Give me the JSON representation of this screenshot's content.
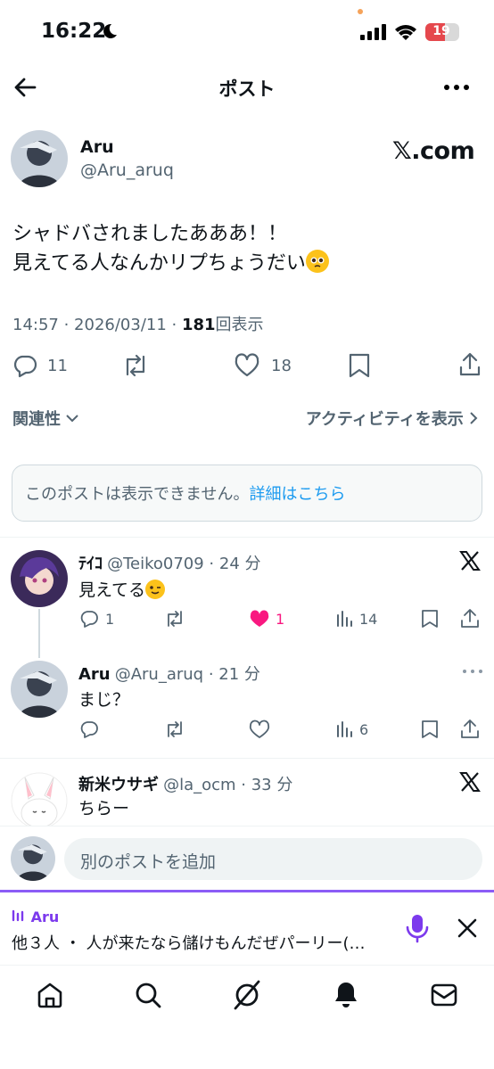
{
  "status_bar": {
    "time": "16:22",
    "battery": "19"
  },
  "header": {
    "title": "ポスト"
  },
  "post": {
    "author_name": "Aru",
    "author_handle": "@Aru_aruq",
    "badge": "𝕏.com",
    "text_line1": "シャドバされましたあああ！！",
    "text_line2": "見えてる人なんかリプちょうだい",
    "time": "14:57 · 2026/03/11 · ",
    "views": "181",
    "views_label": "回表示",
    "replies": "11",
    "likes": "18"
  },
  "filters": {
    "sort_label": "関連性",
    "activity_label": "アクティビティを表示"
  },
  "notice": {
    "text": "このポストは表示できません。",
    "link": "詳細はこちら"
  },
  "replies": [
    {
      "name": "ﾃｲｺ",
      "handle": "@Teiko0709 · 24 分",
      "text": "見えてる",
      "replies": "1",
      "likes": "1",
      "views": "14"
    },
    {
      "name": "Aru",
      "handle": "@Aru_aruq · 21 分",
      "text": "まじ？",
      "views": "6"
    },
    {
      "name": "新米ウサギ",
      "handle": "@la_ocm · 33 分",
      "text": "ちらー"
    }
  ],
  "compose": {
    "placeholder": "別のポストを追加"
  },
  "space": {
    "host": "Aru",
    "title": "他３人 ・ 人が来たなら儲けもんだぜパーリー(…",
    "accent": "#8b5cf6"
  },
  "colors": {
    "like_active": "#f91880",
    "link": "#1d9bf0"
  },
  "icons": [
    "back-icon",
    "more-icon",
    "reply-icon",
    "repost-icon",
    "like-icon",
    "bookmark-icon",
    "share-icon",
    "views-icon",
    "x-logo-icon",
    "mic-icon",
    "close-icon",
    "home-icon",
    "search-icon",
    "grok-icon",
    "bell-icon",
    "mail-icon"
  ]
}
